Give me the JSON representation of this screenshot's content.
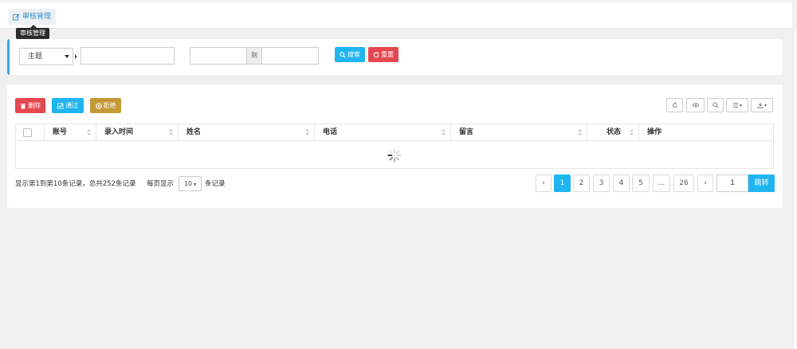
{
  "tab": {
    "label": "审核管理",
    "tooltip": "审核管理"
  },
  "search": {
    "field_select": "主题",
    "keyword_value": "",
    "date_start": "",
    "date_separator": "到",
    "date_end": "",
    "search_button": "搜索",
    "reset_button": "重置"
  },
  "toolbar": {
    "delete_button": "删除",
    "approve_button": "通过",
    "reject_button": "拒绝"
  },
  "table": {
    "columns": [
      "账号",
      "录入时间",
      "姓名",
      "电话",
      "留言",
      "状态",
      "操作"
    ]
  },
  "footer": {
    "summary": "显示第1到第10条记录，总共252条记录",
    "per_page_prefix": "每页显示",
    "per_page_value": "10",
    "per_page_suffix": "条记录"
  },
  "pagination": {
    "prev": "‹",
    "pages": [
      "1",
      "2",
      "3",
      "4",
      "5",
      "...",
      "26"
    ],
    "next": "›",
    "jump_value": "1",
    "jump_button": "跳转"
  },
  "colors": {
    "primary": "#1fb5f0",
    "danger": "#e5474f",
    "warning": "#c29a36",
    "accent": "#3aa7e8"
  }
}
